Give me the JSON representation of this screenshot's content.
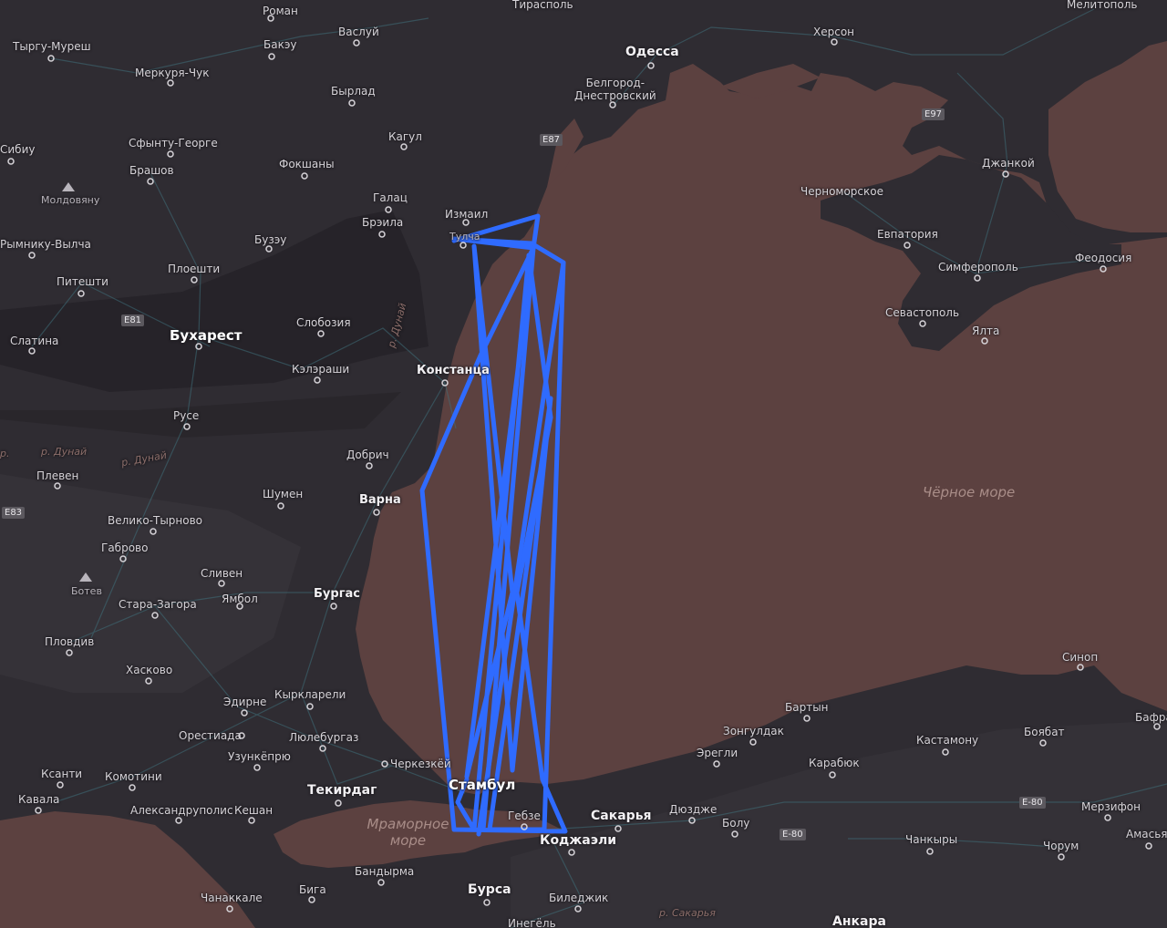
{
  "map": {
    "colors": {
      "land": "#2f2c32",
      "sea": "#5c4140",
      "route": "#2f6bff"
    },
    "seas": [
      {
        "id": "black-sea",
        "label": "Чёрное море"
      },
      {
        "id": "marmara",
        "label": "Мраморное\nморе"
      }
    ],
    "rivers": [
      "р. Дунай",
      "р. Дунай",
      "р. Дунай",
      "р. Дунай",
      "р. Сакарья"
    ],
    "roads": [
      "E87",
      "E97",
      "E81",
      "E83",
      "E-80",
      "E-80"
    ],
    "places": [
      "Роман",
      "Тирасполь",
      "Мелитополь",
      "Тыргу-Муреш",
      "Бакэу",
      "Васлуй",
      "Херсон",
      "Одесса",
      "Меркуря-Чук",
      "Бырлад",
      "Белгород-\nДнестровский",
      "Сибиу",
      "Сфынту-Георге",
      "Кагул",
      "Брашов",
      "Фокшаны",
      "Джанкой",
      "Молдовяну",
      "Галац",
      "Черноморское",
      "Измаил",
      "Брэила",
      "Тулча",
      "Евпатория",
      "Рымнику-Вылча",
      "Бузэу",
      "Симферополь",
      "Феодосия",
      "Плоешти",
      "Питешти",
      "Севастополь",
      "Слобозия",
      "Ялта",
      "Бухарест",
      "Слатина",
      "Кэлэраши",
      "Констанца",
      "Русе",
      "Добрич",
      "Плевен",
      "Шумен",
      "Варна",
      "Велико-Тырново",
      "Габрово",
      "Сливен",
      "Ботев",
      "Стара-Загора",
      "Ямбол",
      "Бургас",
      "Пловдив",
      "Синоп",
      "Хасково",
      "Эдирне",
      "Кыркларели",
      "Бартын",
      "Бафра",
      "Зонгулдак",
      "Боябат",
      "Орестиада",
      "Люлебургаз",
      "Эрегли",
      "Кастамону",
      "Узункёпрю",
      "Карабюк",
      "Черкезкёй",
      "Ксанти",
      "Комотини",
      "Стамбул",
      "Текирдаг",
      "Кавала",
      "Александруполис",
      "Кешан",
      "Гебзе",
      "Сакарья",
      "Дюздже",
      "Мерзифон",
      "Болу",
      "Амасья",
      "Коджаэли",
      "Чанкыры",
      "Чорум",
      "Бандырма",
      "Бига",
      "Бурса",
      "Чанаккале",
      "Биледжик",
      "Инегёль",
      "Анкара"
    ]
  }
}
